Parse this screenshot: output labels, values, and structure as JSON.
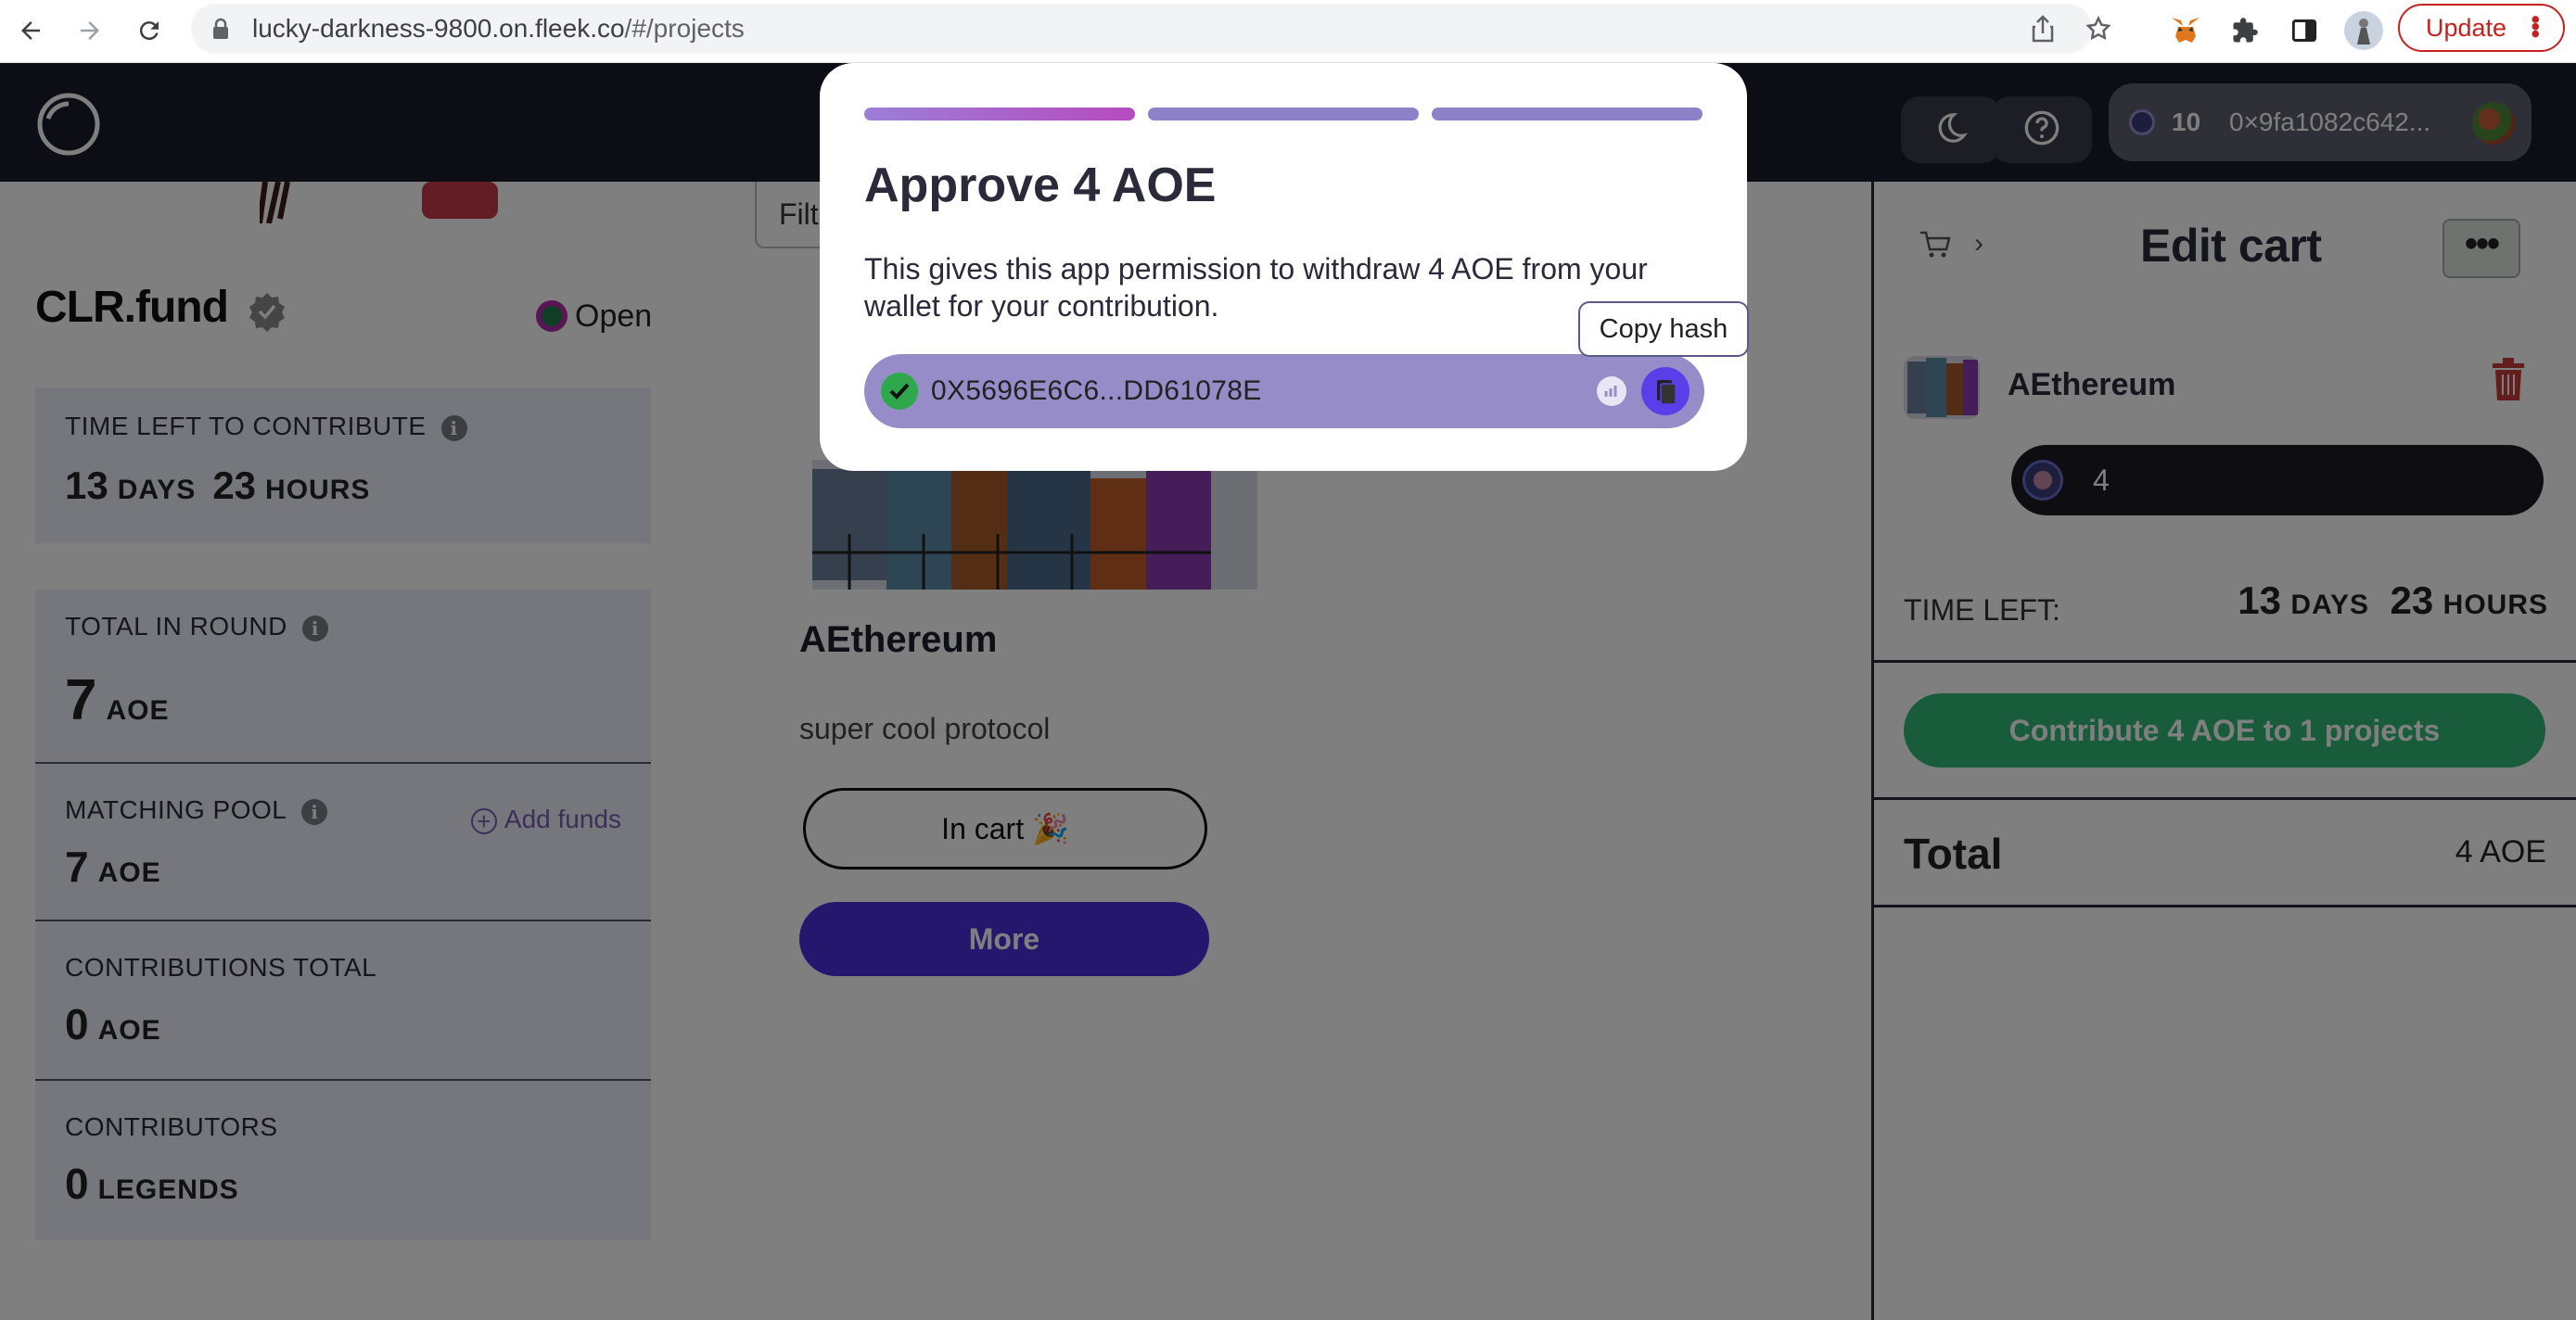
{
  "browser": {
    "url_host": "lucky-darkness-9800.on.fleek.co",
    "url_path": "/#/projects",
    "update_label": "Update"
  },
  "header": {
    "wallet_balance": "10",
    "wallet_address": "0×9fa1082c642..."
  },
  "round": {
    "title": "CLR.fund",
    "status": "Open",
    "time_left": {
      "label": "TIME LEFT TO CONTRIBUTE",
      "days": "13",
      "days_unit": "DAYS",
      "hours": "23",
      "hours_unit": "HOURS"
    },
    "total_in_round": {
      "label": "TOTAL IN ROUND",
      "value": "7",
      "unit": "AOE"
    },
    "matching_pool": {
      "label": "MATCHING POOL",
      "value": "7",
      "unit": "AOE",
      "add_funds": "Add funds"
    },
    "contributions_total": {
      "label": "CONTRIBUTIONS TOTAL",
      "value": "0",
      "unit": "AOE"
    },
    "contributors": {
      "label": "CONTRIBUTORS",
      "value": "0",
      "unit": "LEGENDS"
    }
  },
  "projects": {
    "filter_stub": "Filt",
    "card": {
      "name": "AEthereum",
      "description": "super cool protocol",
      "in_cart_label": "In cart 🎉",
      "more_label": "More"
    }
  },
  "cart": {
    "title": "Edit cart",
    "menu_label": "•••",
    "item_name": "AEthereum",
    "item_amount": "4",
    "time_left_label": "TIME LEFT:",
    "time_left_days": "13",
    "time_left_days_unit": "DAYS",
    "time_left_hours": "23",
    "time_left_hours_unit": "HOURS",
    "contribute_label": "Contribute 4 AOE to 1 projects",
    "total_label": "Total",
    "total_value": "4 AOE"
  },
  "modal": {
    "steps": 3,
    "active_step": 1,
    "title": "Approve 4 AOE",
    "body": "This gives this app permission to withdraw 4 AOE from your wallet for your contribution.",
    "tx_hash": "0X5696E6C6...DD61078E",
    "tooltip": "Copy hash"
  },
  "colors": {
    "header_bg": "#1a1a2b",
    "accent_purple": "#4b2fdc",
    "contribute_green": "#31b878",
    "step_gradient_end": "#b64abf",
    "tx_pill": "#958cc8"
  }
}
